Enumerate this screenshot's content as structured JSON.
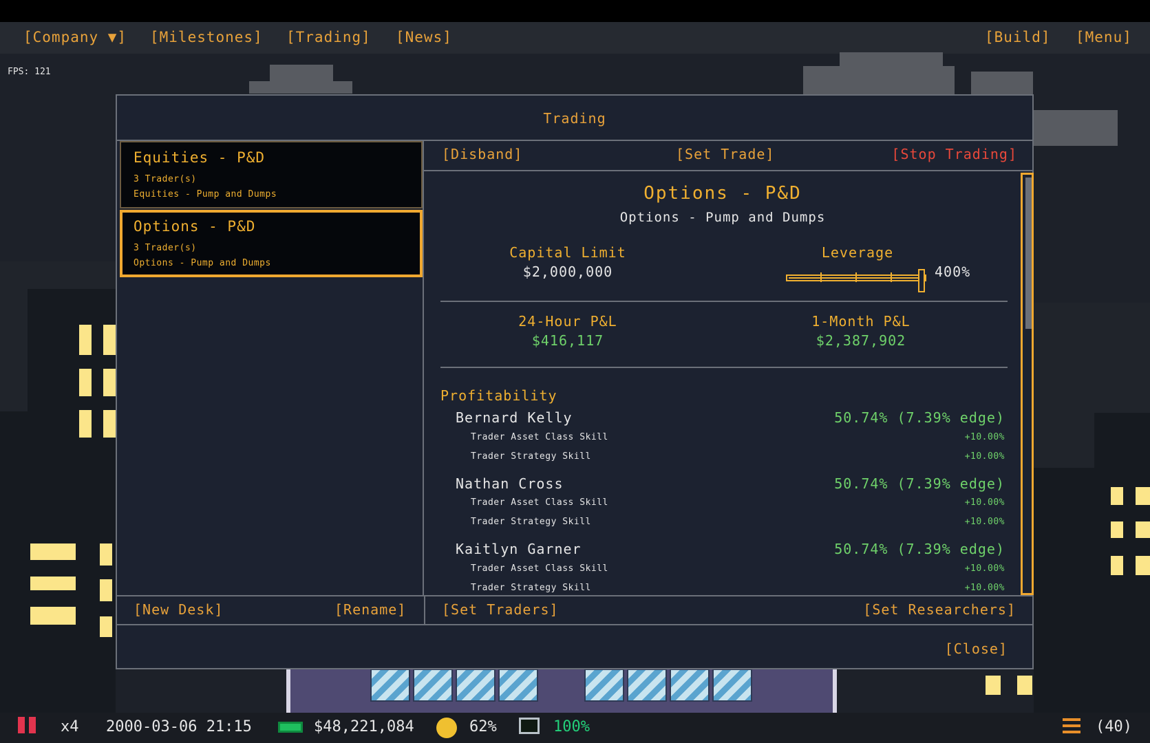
{
  "topbar": {
    "company": "[Company ▼]",
    "milestones": "[Milestones]",
    "trading": "[Trading]",
    "news": "[News]",
    "build": "[Build]",
    "menu": "[Menu]"
  },
  "fps": "FPS: 121",
  "modal": {
    "title": "Trading",
    "desks": [
      {
        "name": "Equities - P&D",
        "traders": "3 Trader(s)",
        "strategy": "Equities - Pump and Dumps",
        "selected": false
      },
      {
        "name": "Options - P&D",
        "traders": "3 Trader(s)",
        "strategy": "Options - Pump and Dumps",
        "selected": true
      }
    ],
    "actions": {
      "disband": "[Disband]",
      "set_trade": "[Set Trade]",
      "stop_trading": "[Stop Trading]"
    },
    "detail": {
      "title": "Options - P&D",
      "subtitle": "Options - Pump and Dumps",
      "capital_limit_label": "Capital Limit",
      "capital_limit_value": "$2,000,000",
      "leverage_label": "Leverage",
      "leverage_value": "400%",
      "leverage_fraction": 1.0,
      "pnl_24h_label": "24-Hour P&L",
      "pnl_24h_value": "$416,117",
      "pnl_1m_label": "1-Month P&L",
      "pnl_1m_value": "$2,387,902",
      "profitability_label": "Profitability",
      "traders": [
        {
          "name": "Bernard Kelly",
          "value": "50.74% (7.39% edge)",
          "skills": [
            {
              "name": "Trader Asset Class Skill",
              "value": "+10.00%"
            },
            {
              "name": "Trader Strategy Skill",
              "value": "+10.00%"
            }
          ]
        },
        {
          "name": "Nathan Cross",
          "value": "50.74% (7.39% edge)",
          "skills": [
            {
              "name": "Trader Asset Class Skill",
              "value": "+10.00%"
            },
            {
              "name": "Trader Strategy Skill",
              "value": "+10.00%"
            }
          ]
        },
        {
          "name": "Kaitlyn Garner",
          "value": "50.74% (7.39% edge)",
          "skills": [
            {
              "name": "Trader Asset Class Skill",
              "value": "+10.00%"
            },
            {
              "name": "Trader Strategy Skill",
              "value": "+10.00%"
            }
          ]
        }
      ]
    },
    "bottom": {
      "new_desk": "[New Desk]",
      "rename": "[Rename]",
      "set_traders": "[Set Traders]",
      "set_researchers": "[Set Researchers]"
    },
    "close": "[Close]"
  },
  "status": {
    "speed": "x4",
    "datetime": "2000-03-06 21:15",
    "cash": "$48,221,084",
    "happiness": "62%",
    "uptime": "100%",
    "queue_count": "(40)"
  },
  "colors": {
    "accent": "#f0b030",
    "profit": "#6fd26a",
    "danger": "#e8483a",
    "panel": "#1c2230"
  },
  "icons": [
    "pause-icon",
    "cash-icon",
    "smiley-icon",
    "monitor-icon",
    "list-icon"
  ]
}
